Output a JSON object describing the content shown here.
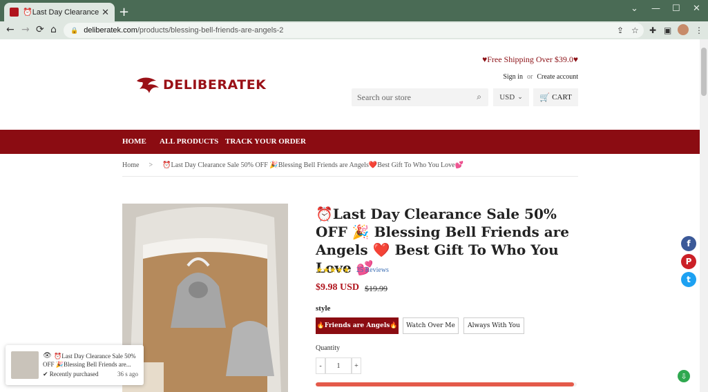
{
  "browser": {
    "tab_title": "⏰Last Day Clearance Sale 50% O",
    "tab_close": "✕",
    "new_tab": "+",
    "window_controls": [
      "⌄",
      "—",
      "☐",
      "✕"
    ],
    "nav": {
      "back": "←",
      "forward": "→",
      "reload": "⟳",
      "home": "⌂"
    },
    "url_host": "deliberatek.com",
    "url_path": "/products/blessing-bell-friends-are-angels-2",
    "toolbar_icons": [
      "share-icon",
      "star-icon",
      "extensions-icon",
      "sidepanel-icon",
      "avatar-icon",
      "menu-icon"
    ]
  },
  "header": {
    "shipping_banner": "♥Free Shipping Over $39.0♥",
    "sign_in": "Sign in",
    "or": "or",
    "create_account": "Create account",
    "logo_text": "DELIBERATEK",
    "search_placeholder": "Search our store",
    "currency": "USD",
    "cart_label": "CART"
  },
  "nav": {
    "items": [
      "HOME",
      "ALL PRODUCTS",
      "TRACK YOUR ORDER"
    ]
  },
  "breadcrumb": {
    "home": "Home",
    "separator": ">",
    "current": "⏰Last Day Clearance Sale 50% OFF 🎉Blessing Bell Friends are Angels❤️Best Gift To Who You Love💕"
  },
  "product": {
    "title": "⏰Last Day Clearance Sale 50% OFF 🎉 Blessing Bell Friends are Angels ❤️ Best Gift To Who You Love 💕",
    "rating": 5,
    "stars": "★★★★★",
    "reviews": "25 Reviews",
    "price": "$9.98 USD",
    "compare_price": "$19.99",
    "style_label": "style",
    "variants": [
      "🔥Friends are Angels🔥",
      "Watch Over Me",
      "Always With You"
    ],
    "selected_variant": "🔥Friends are Angels🔥",
    "quantity_label": "Quantity",
    "quantity": "1",
    "minus": "-",
    "plus": "+",
    "stock_progress": 0.99
  },
  "social": {
    "facebook": "f",
    "pinterest": "P",
    "twitter": "t",
    "colors": {
      "facebook": "#3b5998",
      "pinterest": "#cb2027",
      "twitter": "#1da1f2"
    }
  },
  "popup": {
    "text": "⏰Last Day Clearance Sale 50% OFF 🎉Blessing Bell Friends are...",
    "verified": "Recently purchased",
    "ago": "36 s ago"
  },
  "colors": {
    "brand": "#8b0c12",
    "price": "#b0141d",
    "link": "#3c6fb4",
    "chrome": "#4a6b55"
  }
}
